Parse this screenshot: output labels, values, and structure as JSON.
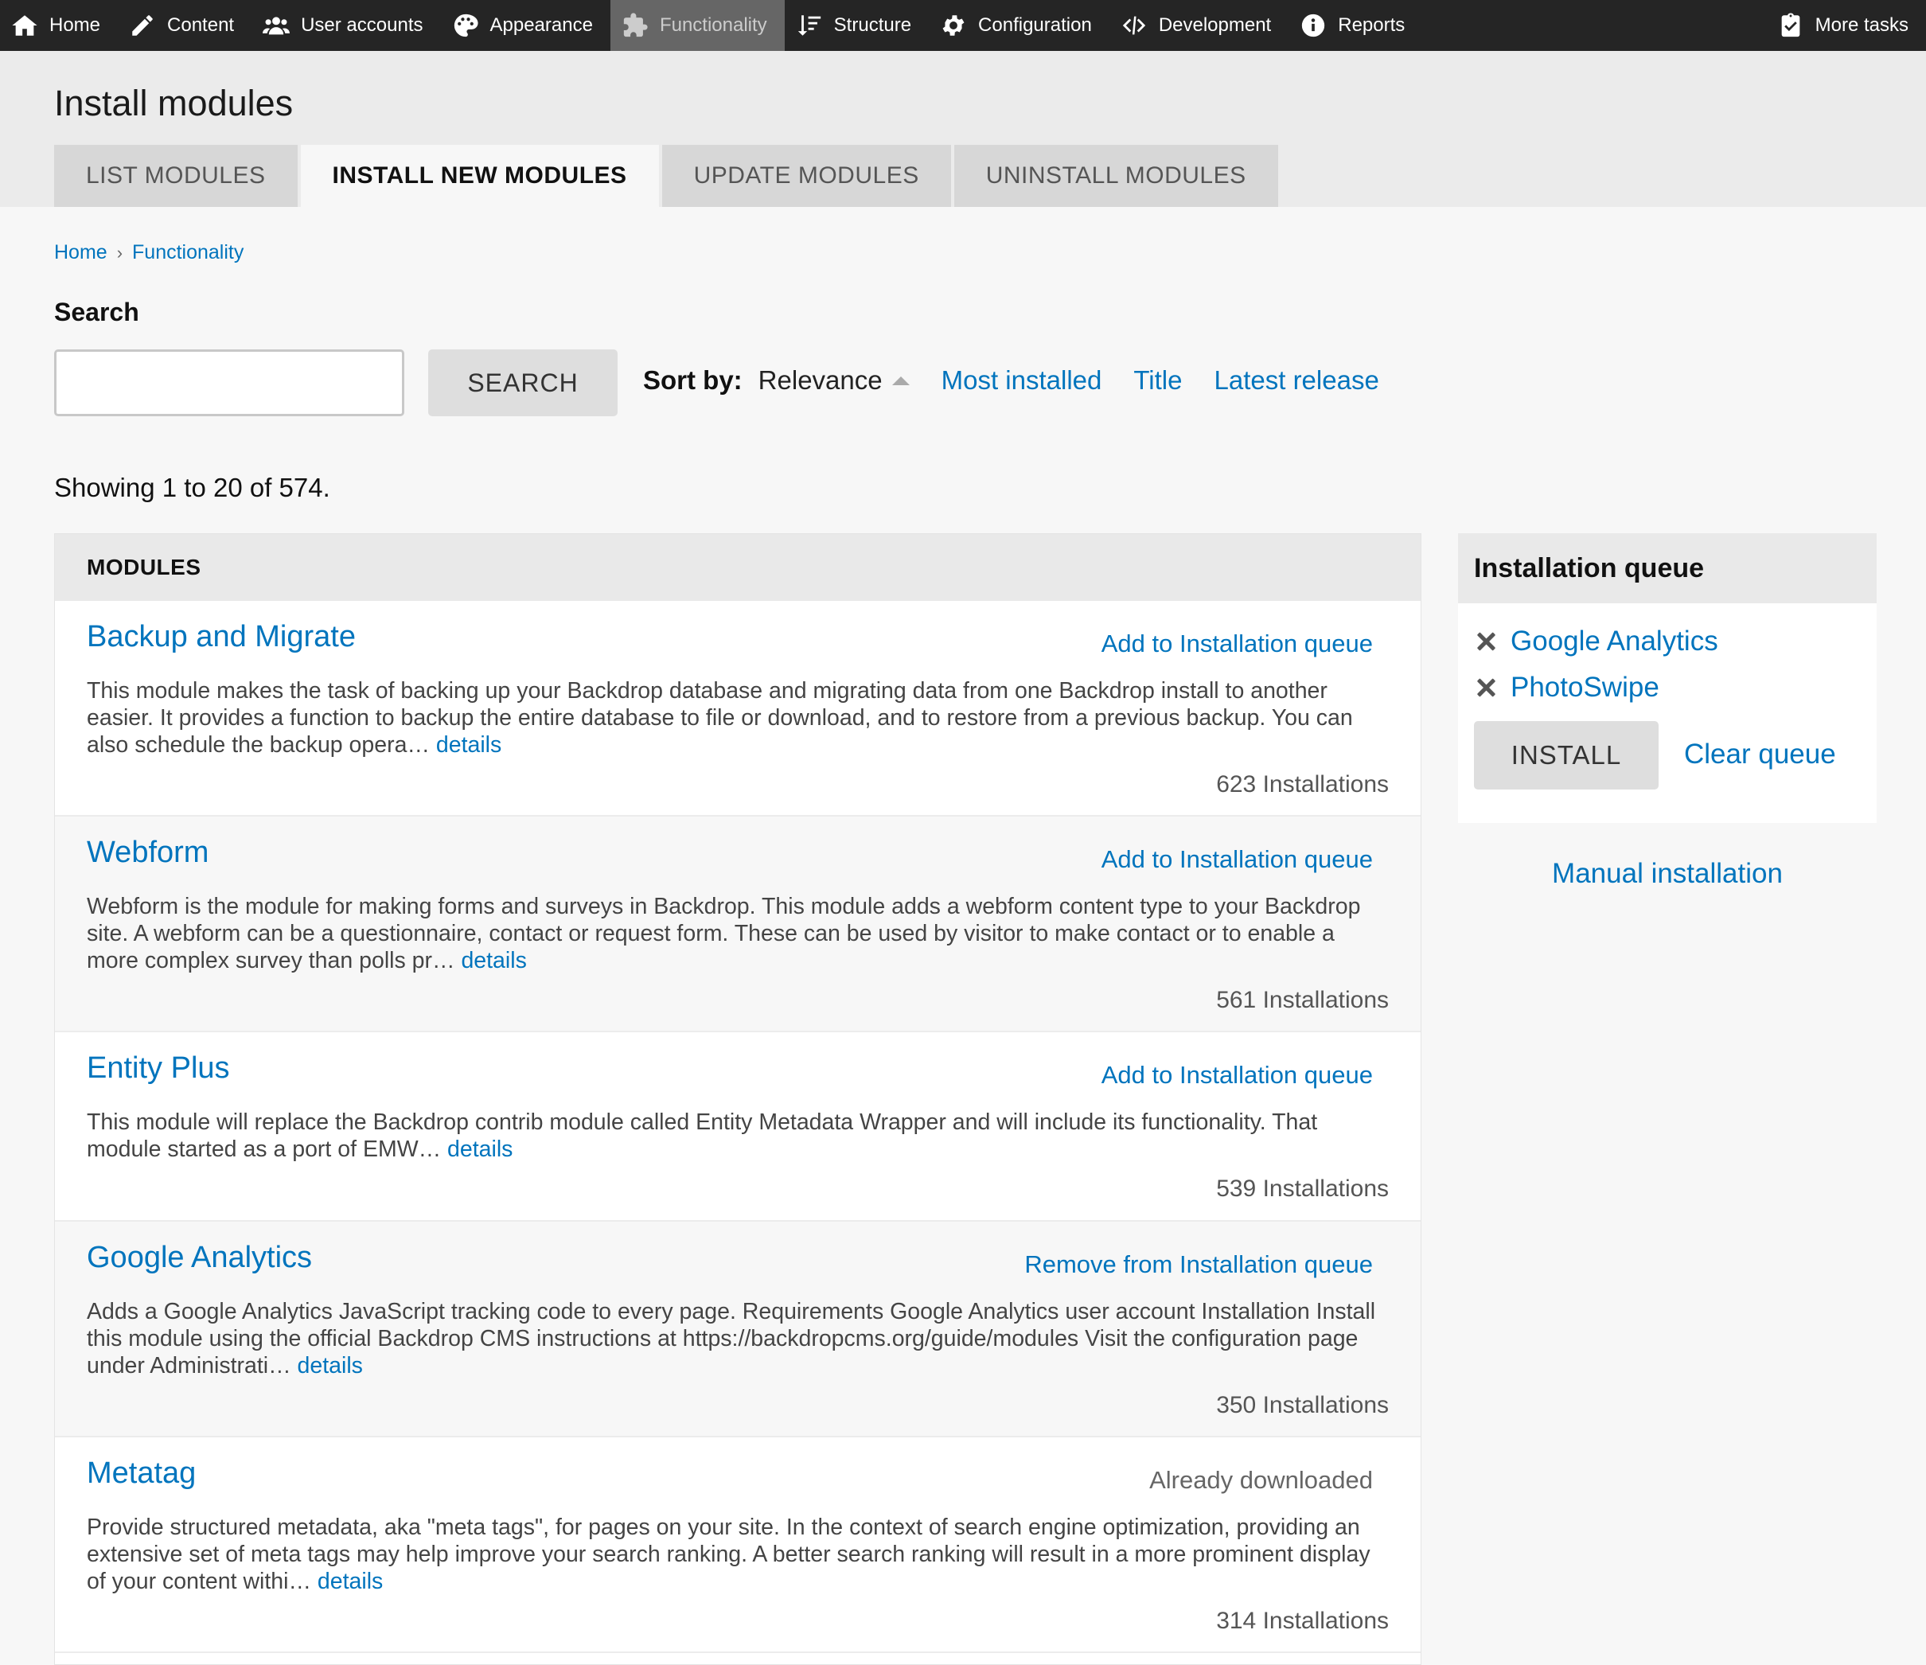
{
  "topbar": {
    "items": [
      {
        "label": "Home",
        "icon": "home-icon"
      },
      {
        "label": "Content",
        "icon": "pencil-icon"
      },
      {
        "label": "User accounts",
        "icon": "users-icon"
      },
      {
        "label": "Appearance",
        "icon": "palette-icon"
      },
      {
        "label": "Functionality",
        "icon": "puzzle-icon",
        "active": true
      },
      {
        "label": "Structure",
        "icon": "sort-icon"
      },
      {
        "label": "Configuration",
        "icon": "gear-icon"
      },
      {
        "label": "Development",
        "icon": "code-icon"
      },
      {
        "label": "Reports",
        "icon": "info-icon"
      }
    ],
    "more_tasks": {
      "label": "More tasks",
      "icon": "clipboard-check-icon"
    }
  },
  "page": {
    "title": "Install modules",
    "tabs": [
      {
        "label": "LIST MODULES"
      },
      {
        "label": "INSTALL NEW MODULES",
        "active": true
      },
      {
        "label": "UPDATE MODULES"
      },
      {
        "label": "UNINSTALL MODULES"
      }
    ],
    "breadcrumb": [
      "Home",
      "Functionality"
    ]
  },
  "search": {
    "label": "Search",
    "value": "",
    "placeholder": "",
    "button_label": "SEARCH"
  },
  "sort": {
    "label": "Sort by:",
    "current": "Relevance",
    "options": [
      "Most installed",
      "Title",
      "Latest release"
    ]
  },
  "results": {
    "showing": "Showing 1 to 20 of 574."
  },
  "modules": {
    "header": "MODULES",
    "items": [
      {
        "name": "Backup and Migrate",
        "action": "Add to Installation queue",
        "description": "This module makes the task of backing up your Backdrop database and migrating data from one Backdrop install to another easier. It provides a function to backup the entire database to file or download, and to restore from a previous backup. You can also schedule the backup opera…",
        "details": "details",
        "installs": "623 Installations"
      },
      {
        "name": "Webform",
        "action": "Add to Installation queue",
        "description": "Webform is the module for making forms and surveys in Backdrop. This module adds a webform content type to your Backdrop site. A webform can be a questionnaire, contact or request form. These can be used by visitor to make contact or to enable a more complex survey than polls pr…",
        "details": "details",
        "installs": "561 Installations"
      },
      {
        "name": "Entity Plus",
        "action": "Add to Installation queue",
        "description": "This module will replace the Backdrop contrib module called Entity Metadata Wrapper and will include its functionality. That module started as a port of EMW…",
        "details": "details",
        "installs": "539 Installations"
      },
      {
        "name": "Google Analytics",
        "action": "Remove from Installation queue",
        "description": "Adds a Google Analytics JavaScript tracking code to every page. Requirements Google Analytics user account Installation Install this module using the official Backdrop CMS instructions at https://backdropcms.org/guide/modules Visit the configuration page under Administrati…",
        "details": "details",
        "installs": "350 Installations"
      },
      {
        "name": "Metatag",
        "action": "Already downloaded",
        "description": "Provide structured metadata, aka \"meta tags\", for pages on your site. In the context of search engine optimization, providing an extensive set of meta tags may help improve your search ranking. A better search ranking will result in a more prominent display of your content withi…",
        "details": "details",
        "installs": "314 Installations"
      }
    ]
  },
  "queue": {
    "title": "Installation queue",
    "items": [
      "Google Analytics",
      "PhotoSwipe"
    ],
    "install_label": "INSTALL",
    "clear_label": "Clear queue",
    "manual_label": "Manual installation"
  }
}
